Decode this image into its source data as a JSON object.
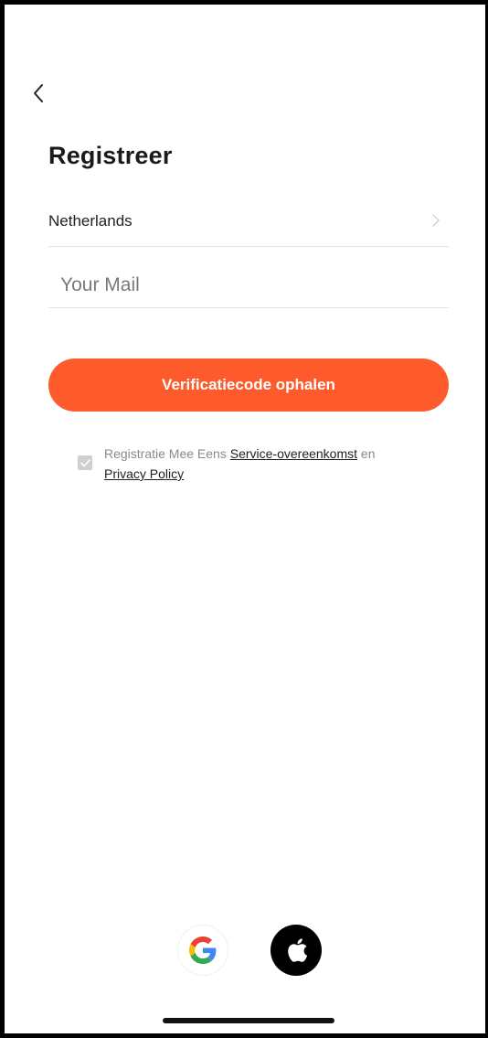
{
  "header": {
    "back_icon": "chevron-left-icon",
    "title": "Registreer"
  },
  "form": {
    "country": "Netherlands",
    "country_chevron_icon": "chevron-right-icon",
    "email_value": "",
    "email_placeholder": "Your Mail",
    "submit_label": "Verificatiecode ophalen",
    "accent_color": "#fd5b2b"
  },
  "agreement": {
    "checked": true,
    "prefix": "Registratie Mee Eens",
    "service_link": "Service-overeenkomst",
    "connector": "en",
    "privacy_link": "Privacy Policy"
  },
  "social": {
    "google_icon": "google-icon",
    "apple_icon": "apple-icon"
  }
}
